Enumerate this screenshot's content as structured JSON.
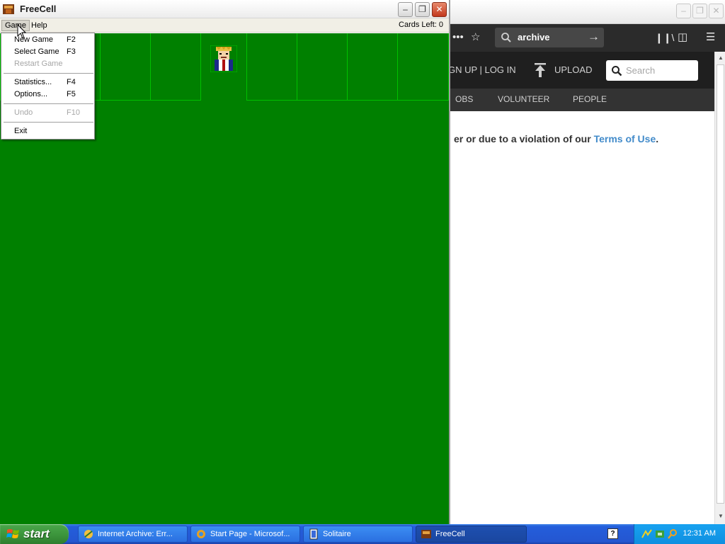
{
  "browser": {
    "search_value": "archive",
    "topnav": {
      "signup_login": "GN UP | LOG IN",
      "upload": "UPLOAD",
      "search_placeholder": "Search"
    },
    "subnav": [
      "OBS",
      "VOLUNTEER",
      "PEOPLE"
    ],
    "message_text": "er or due to a violation of our ",
    "message_link": "Terms of Use",
    "message_end": "."
  },
  "freecell": {
    "title": "FreeCell",
    "menus": [
      "Game",
      "Help"
    ],
    "cards_left": "Cards Left: 0",
    "felt_color": "#008000",
    "game_menu": [
      {
        "label": "New Game",
        "key": "F2",
        "enabled": true
      },
      {
        "label": "Select Game",
        "key": "F3",
        "enabled": true
      },
      {
        "label": "Restart Game",
        "key": "",
        "enabled": false
      },
      {
        "label": "Statistics...",
        "key": "F4",
        "enabled": true
      },
      {
        "label": "Options...",
        "key": "F5",
        "enabled": true
      },
      {
        "label": "Undo",
        "key": "F10",
        "enabled": false
      },
      {
        "label": "Exit",
        "key": "",
        "enabled": true
      }
    ]
  },
  "taskbar": {
    "start_label": "start",
    "tasks": [
      {
        "label": "Internet Archive: Err...",
        "icon": "archive-icon"
      },
      {
        "label": "Start Page - Microsof...",
        "icon": "ie-icon"
      },
      {
        "label": "Solitaire",
        "icon": "solitaire-icon"
      },
      {
        "label": "FreeCell",
        "icon": "freecell-icon",
        "active": true
      }
    ],
    "help_tray": "?",
    "clock": "12:31 AM"
  }
}
